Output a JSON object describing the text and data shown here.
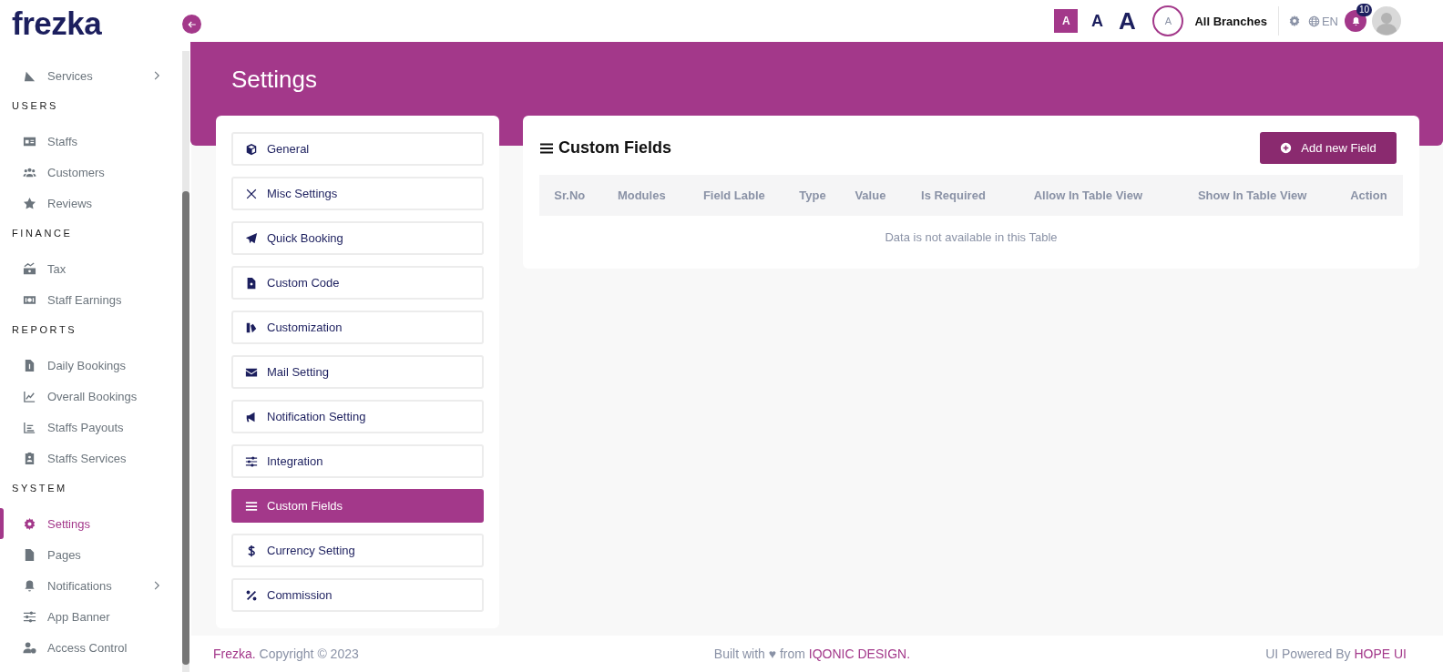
{
  "logo": "frezka",
  "sidebar": {
    "items": [
      {
        "kind": "link",
        "label": "Services",
        "selected": false,
        "expandable": true
      },
      {
        "kind": "heading",
        "label": "USERS"
      },
      {
        "kind": "link",
        "label": "Staffs",
        "selected": false,
        "expandable": false
      },
      {
        "kind": "link",
        "label": "Customers",
        "selected": false,
        "expandable": false
      },
      {
        "kind": "link",
        "label": "Reviews",
        "selected": false,
        "expandable": false
      },
      {
        "kind": "heading",
        "label": "FINANCE"
      },
      {
        "kind": "link",
        "label": "Tax",
        "selected": false,
        "expandable": false
      },
      {
        "kind": "link",
        "label": "Staff Earnings",
        "selected": false,
        "expandable": false
      },
      {
        "kind": "heading",
        "label": "REPORTS"
      },
      {
        "kind": "link",
        "label": "Daily Bookings",
        "selected": false,
        "expandable": false
      },
      {
        "kind": "link",
        "label": "Overall Bookings",
        "selected": false,
        "expandable": false
      },
      {
        "kind": "link",
        "label": "Staffs Payouts",
        "selected": false,
        "expandable": false
      },
      {
        "kind": "link",
        "label": "Staffs Services",
        "selected": false,
        "expandable": false
      },
      {
        "kind": "heading",
        "label": "SYSTEM"
      },
      {
        "kind": "link",
        "label": "Settings",
        "selected": true,
        "expandable": false
      },
      {
        "kind": "link",
        "label": "Pages",
        "selected": false,
        "expandable": false
      },
      {
        "kind": "link",
        "label": "Notifications",
        "selected": false,
        "expandable": true
      },
      {
        "kind": "link",
        "label": "App Banner",
        "selected": false,
        "expandable": false
      },
      {
        "kind": "link",
        "label": "Access Control",
        "selected": false,
        "expandable": false
      }
    ]
  },
  "topbar": {
    "font_sizes": [
      {
        "label": "A",
        "selected": true
      },
      {
        "label": "A",
        "selected": false
      },
      {
        "label": "A",
        "selected": false
      }
    ],
    "branch_avatar": "A",
    "branch": "All Branches",
    "language": "EN",
    "notification_count": "10"
  },
  "page_title": "Settings",
  "settings_menu": [
    {
      "label": "General",
      "selected": false
    },
    {
      "label": "Misc Settings",
      "selected": false
    },
    {
      "label": "Quick Booking",
      "selected": false
    },
    {
      "label": "Custom Code",
      "selected": false
    },
    {
      "label": "Customization",
      "selected": false
    },
    {
      "label": "Mail Setting",
      "selected": false
    },
    {
      "label": "Notification Setting",
      "selected": false
    },
    {
      "label": "Integration",
      "selected": false
    },
    {
      "label": "Custom Fields",
      "selected": true
    },
    {
      "label": "Currency Setting",
      "selected": false
    },
    {
      "label": "Commission",
      "selected": false
    }
  ],
  "custom_fields": {
    "title": "Custom Fields",
    "add_button": "Add new Field",
    "columns": [
      "Sr.No",
      "Modules",
      "Field Lable",
      "Type",
      "Value",
      "Is Required",
      "Allow In Table View",
      "Show In Table View",
      "Action"
    ],
    "empty_message": "Data is not available in this Table"
  },
  "footer": {
    "brand": "Frezka.",
    "copyright": "Copyright © 2023",
    "built_with": "Built with ♥ from",
    "built_link": "IQONIC DESIGN.",
    "powered_by": "UI Powered By",
    "powered_link": "HOPE UI"
  }
}
